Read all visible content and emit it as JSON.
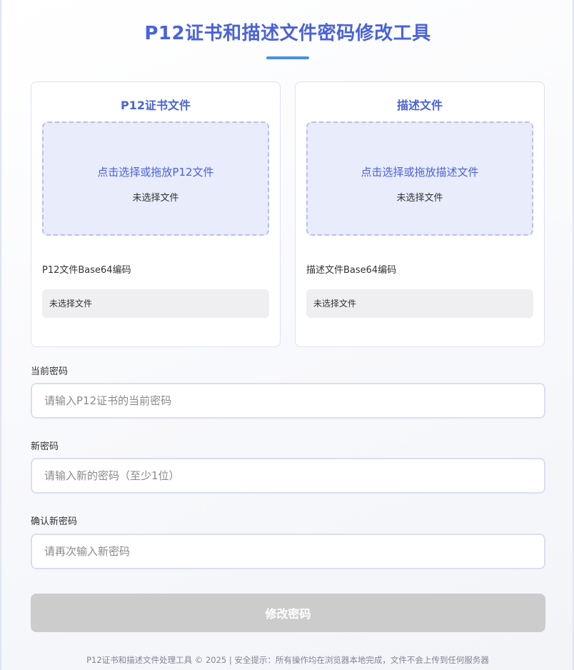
{
  "header": {
    "title": "P12证书和描述文件密码修改工具"
  },
  "p12_card": {
    "title": "P12证书文件",
    "dropzone_text": "点击选择或拖放P12文件",
    "file_status": "未选择文件",
    "base64_label": "P12文件Base64编码",
    "base64_value": "未选择文件"
  },
  "profile_card": {
    "title": "描述文件",
    "dropzone_text": "点击选择或拖放描述文件",
    "file_status": "未选择文件",
    "base64_label": "描述文件Base64编码",
    "base64_value": "未选择文件"
  },
  "form": {
    "current_password_label": "当前密码",
    "current_password_placeholder": "请输入P12证书的当前密码",
    "new_password_label": "新密码",
    "new_password_placeholder": "请输入新的密码（至少1位）",
    "confirm_password_label": "确认新密码",
    "confirm_password_placeholder": "请再次输入新密码",
    "submit_label": "修改密码"
  },
  "footer": {
    "text": "P12证书和描述文件处理工具 © 2025 | 安全提示：所有操作均在浏览器本地完成，文件不会上传到任何服务器"
  },
  "colors": {
    "accent": "#4a63d8",
    "accent_bar": "#4a90e2",
    "dropzone_bg": "#e8ecfb",
    "disabled_button": "#cccccc"
  }
}
